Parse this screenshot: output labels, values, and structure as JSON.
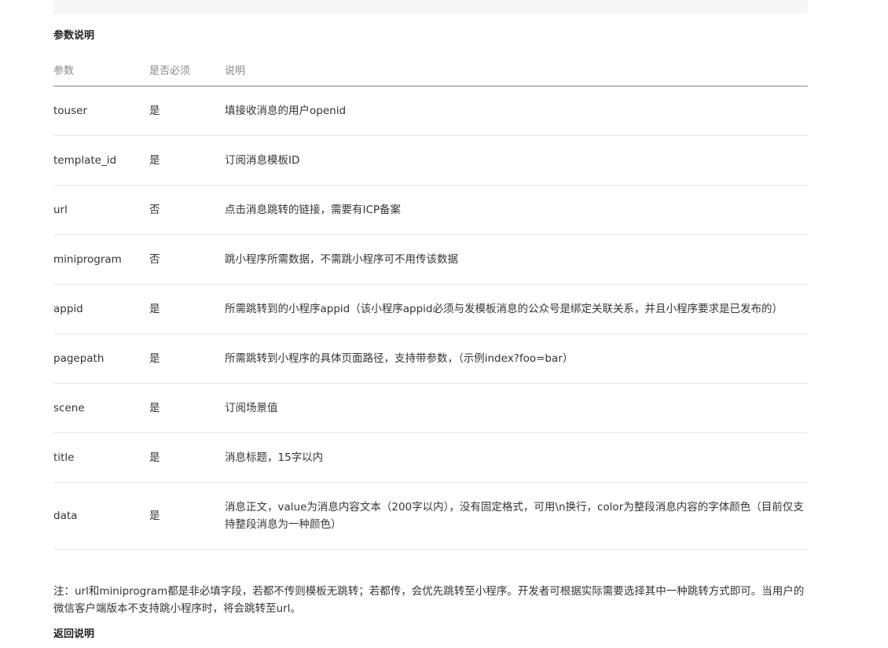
{
  "section_params_title": "参数说明",
  "table": {
    "headers": [
      "参数",
      "是否必须",
      "说明"
    ],
    "rows": [
      {
        "param": "touser",
        "required": "是",
        "desc": "填接收消息的用户openid"
      },
      {
        "param": "template_id",
        "required": "是",
        "desc": "订阅消息模板ID"
      },
      {
        "param": "url",
        "required": "否",
        "desc": "点击消息跳转的链接，需要有ICP备案"
      },
      {
        "param": "miniprogram",
        "required": "否",
        "desc": "跳小程序所需数据，不需跳小程序可不用传该数据"
      },
      {
        "param": "appid",
        "required": "是",
        "desc": "所需跳转到的小程序appid（该小程序appid必须与发模板消息的公众号是绑定关联关系，并且小程序要求是已发布的）"
      },
      {
        "param": "pagepath",
        "required": "是",
        "desc": "所需跳转到小程序的具体页面路径，支持带参数，（示例index?foo=bar）"
      },
      {
        "param": "scene",
        "required": "是",
        "desc": "订阅场景值"
      },
      {
        "param": "title",
        "required": "是",
        "desc": "消息标题，15字以内"
      },
      {
        "param": "data",
        "required": "是",
        "desc": "消息正文，value为消息内容文本（200字以内），没有固定格式，可用\\n换行，color为整段消息内容的字体颜色（目前仅支持整段消息为一种颜色）"
      }
    ]
  },
  "note": "注：url和miniprogram都是非必填字段，若都不传则模板无跳转；若都传，会优先跳转至小程序。开发者可根据实际需要选择其中一种跳转方式即可。当用户的微信客户端版本不支持跳小程序时，将会跳转至url。",
  "section_return_title": "返回说明"
}
